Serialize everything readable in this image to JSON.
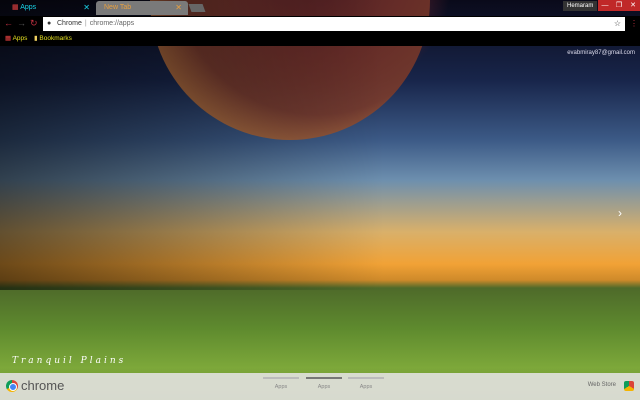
{
  "tabs": [
    {
      "label": "Apps",
      "icon": "apps-grid-icon"
    },
    {
      "label": "New Tab"
    }
  ],
  "user": "Hemaram",
  "window_controls": {
    "minimize": "—",
    "restore": "❐",
    "close": "✕"
  },
  "toolbar": {
    "back": "←",
    "forward": "→",
    "reload": "↻",
    "site_label": "Chrome",
    "url": "chrome://apps",
    "star": "☆",
    "menu": "⋮"
  },
  "bookmarks": [
    {
      "label": "Apps"
    },
    {
      "label": "Bookmarks"
    }
  ],
  "email": "evabmiray87@gmail.com",
  "next_arrow": "›",
  "caption": "Tranquil Plains",
  "footer": {
    "logo_text": "chrome",
    "pages": [
      {
        "label": "Apps",
        "active": false
      },
      {
        "label": "Apps",
        "active": true
      },
      {
        "label": "Apps",
        "active": false
      }
    ],
    "web_store": "Web Store"
  }
}
